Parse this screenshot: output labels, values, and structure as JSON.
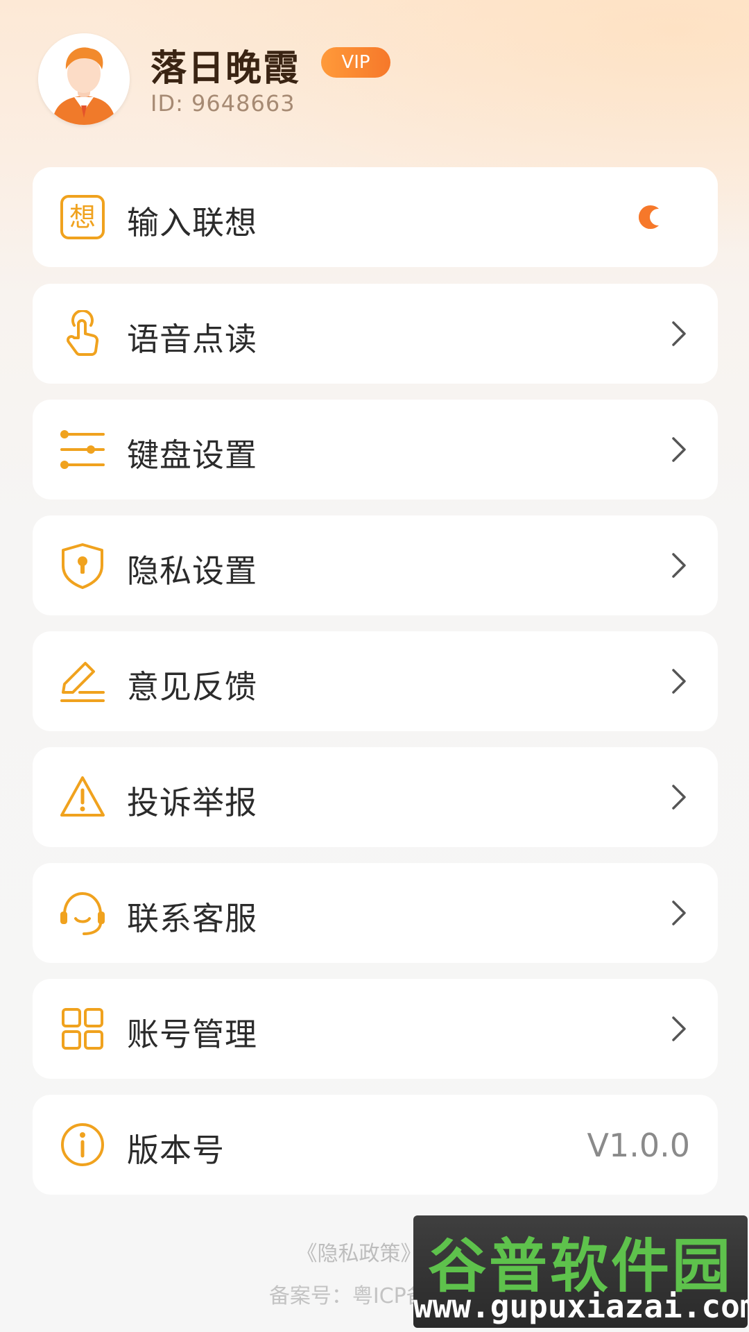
{
  "profile": {
    "name": "落日晚霞",
    "badge": "VIP",
    "id_text": "ID:  9648663"
  },
  "menu": [
    {
      "label": "输入联想",
      "icon": "think-icon",
      "control": "toggle"
    },
    {
      "label": "语音点读",
      "icon": "tap-hand-icon",
      "control": "chevron"
    },
    {
      "label": "键盘设置",
      "icon": "sliders-icon",
      "control": "chevron"
    },
    {
      "label": "隐私设置",
      "icon": "shield-lock-icon",
      "control": "chevron"
    },
    {
      "label": "意见反馈",
      "icon": "pen-icon",
      "control": "chevron"
    },
    {
      "label": "投诉举报",
      "icon": "warning-icon",
      "control": "chevron"
    },
    {
      "label": "联系客服",
      "icon": "headset-icon",
      "control": "chevron"
    },
    {
      "label": "账号管理",
      "icon": "grid-icon",
      "control": "chevron"
    },
    {
      "label": "版本号",
      "icon": "info-icon",
      "control": "value",
      "value": "V1.0.0"
    }
  ],
  "icon_glyphs": {
    "think": "想"
  },
  "footer": {
    "links": "《隐私政策》《用",
    "icp": "备案号：粤ICP备2025"
  },
  "watermark": {
    "title": "谷普软件园",
    "url": "www.gupuxiazai.com"
  },
  "colors": {
    "accent": "#f6782a",
    "icon": "#f0a21e",
    "title": "#3a2413",
    "background": "#f6f6f6"
  }
}
